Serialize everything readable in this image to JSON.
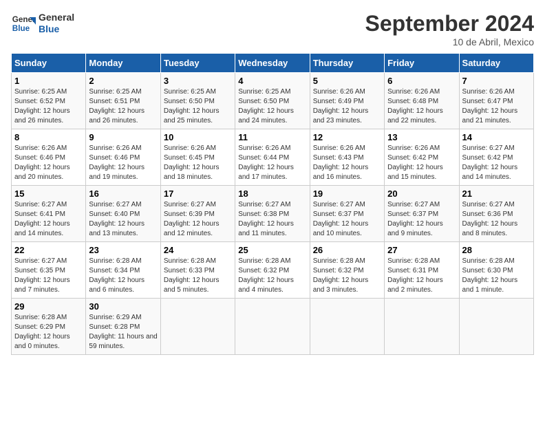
{
  "logo": {
    "line1": "General",
    "line2": "Blue"
  },
  "title": "September 2024",
  "subtitle": "10 de Abril, Mexico",
  "weekdays": [
    "Sunday",
    "Monday",
    "Tuesday",
    "Wednesday",
    "Thursday",
    "Friday",
    "Saturday"
  ],
  "weeks": [
    [
      {
        "day": "1",
        "sunrise": "Sunrise: 6:25 AM",
        "sunset": "Sunset: 6:52 PM",
        "daylight": "Daylight: 12 hours and 26 minutes."
      },
      {
        "day": "2",
        "sunrise": "Sunrise: 6:25 AM",
        "sunset": "Sunset: 6:51 PM",
        "daylight": "Daylight: 12 hours and 26 minutes."
      },
      {
        "day": "3",
        "sunrise": "Sunrise: 6:25 AM",
        "sunset": "Sunset: 6:50 PM",
        "daylight": "Daylight: 12 hours and 25 minutes."
      },
      {
        "day": "4",
        "sunrise": "Sunrise: 6:25 AM",
        "sunset": "Sunset: 6:50 PM",
        "daylight": "Daylight: 12 hours and 24 minutes."
      },
      {
        "day": "5",
        "sunrise": "Sunrise: 6:26 AM",
        "sunset": "Sunset: 6:49 PM",
        "daylight": "Daylight: 12 hours and 23 minutes."
      },
      {
        "day": "6",
        "sunrise": "Sunrise: 6:26 AM",
        "sunset": "Sunset: 6:48 PM",
        "daylight": "Daylight: 12 hours and 22 minutes."
      },
      {
        "day": "7",
        "sunrise": "Sunrise: 6:26 AM",
        "sunset": "Sunset: 6:47 PM",
        "daylight": "Daylight: 12 hours and 21 minutes."
      }
    ],
    [
      {
        "day": "8",
        "sunrise": "Sunrise: 6:26 AM",
        "sunset": "Sunset: 6:46 PM",
        "daylight": "Daylight: 12 hours and 20 minutes."
      },
      {
        "day": "9",
        "sunrise": "Sunrise: 6:26 AM",
        "sunset": "Sunset: 6:46 PM",
        "daylight": "Daylight: 12 hours and 19 minutes."
      },
      {
        "day": "10",
        "sunrise": "Sunrise: 6:26 AM",
        "sunset": "Sunset: 6:45 PM",
        "daylight": "Daylight: 12 hours and 18 minutes."
      },
      {
        "day": "11",
        "sunrise": "Sunrise: 6:26 AM",
        "sunset": "Sunset: 6:44 PM",
        "daylight": "Daylight: 12 hours and 17 minutes."
      },
      {
        "day": "12",
        "sunrise": "Sunrise: 6:26 AM",
        "sunset": "Sunset: 6:43 PM",
        "daylight": "Daylight: 12 hours and 16 minutes."
      },
      {
        "day": "13",
        "sunrise": "Sunrise: 6:26 AM",
        "sunset": "Sunset: 6:42 PM",
        "daylight": "Daylight: 12 hours and 15 minutes."
      },
      {
        "day": "14",
        "sunrise": "Sunrise: 6:27 AM",
        "sunset": "Sunset: 6:42 PM",
        "daylight": "Daylight: 12 hours and 14 minutes."
      }
    ],
    [
      {
        "day": "15",
        "sunrise": "Sunrise: 6:27 AM",
        "sunset": "Sunset: 6:41 PM",
        "daylight": "Daylight: 12 hours and 14 minutes."
      },
      {
        "day": "16",
        "sunrise": "Sunrise: 6:27 AM",
        "sunset": "Sunset: 6:40 PM",
        "daylight": "Daylight: 12 hours and 13 minutes."
      },
      {
        "day": "17",
        "sunrise": "Sunrise: 6:27 AM",
        "sunset": "Sunset: 6:39 PM",
        "daylight": "Daylight: 12 hours and 12 minutes."
      },
      {
        "day": "18",
        "sunrise": "Sunrise: 6:27 AM",
        "sunset": "Sunset: 6:38 PM",
        "daylight": "Daylight: 12 hours and 11 minutes."
      },
      {
        "day": "19",
        "sunrise": "Sunrise: 6:27 AM",
        "sunset": "Sunset: 6:37 PM",
        "daylight": "Daylight: 12 hours and 10 minutes."
      },
      {
        "day": "20",
        "sunrise": "Sunrise: 6:27 AM",
        "sunset": "Sunset: 6:37 PM",
        "daylight": "Daylight: 12 hours and 9 minutes."
      },
      {
        "day": "21",
        "sunrise": "Sunrise: 6:27 AM",
        "sunset": "Sunset: 6:36 PM",
        "daylight": "Daylight: 12 hours and 8 minutes."
      }
    ],
    [
      {
        "day": "22",
        "sunrise": "Sunrise: 6:27 AM",
        "sunset": "Sunset: 6:35 PM",
        "daylight": "Daylight: 12 hours and 7 minutes."
      },
      {
        "day": "23",
        "sunrise": "Sunrise: 6:28 AM",
        "sunset": "Sunset: 6:34 PM",
        "daylight": "Daylight: 12 hours and 6 minutes."
      },
      {
        "day": "24",
        "sunrise": "Sunrise: 6:28 AM",
        "sunset": "Sunset: 6:33 PM",
        "daylight": "Daylight: 12 hours and 5 minutes."
      },
      {
        "day": "25",
        "sunrise": "Sunrise: 6:28 AM",
        "sunset": "Sunset: 6:32 PM",
        "daylight": "Daylight: 12 hours and 4 minutes."
      },
      {
        "day": "26",
        "sunrise": "Sunrise: 6:28 AM",
        "sunset": "Sunset: 6:32 PM",
        "daylight": "Daylight: 12 hours and 3 minutes."
      },
      {
        "day": "27",
        "sunrise": "Sunrise: 6:28 AM",
        "sunset": "Sunset: 6:31 PM",
        "daylight": "Daylight: 12 hours and 2 minutes."
      },
      {
        "day": "28",
        "sunrise": "Sunrise: 6:28 AM",
        "sunset": "Sunset: 6:30 PM",
        "daylight": "Daylight: 12 hours and 1 minute."
      }
    ],
    [
      {
        "day": "29",
        "sunrise": "Sunrise: 6:28 AM",
        "sunset": "Sunset: 6:29 PM",
        "daylight": "Daylight: 12 hours and 0 minutes."
      },
      {
        "day": "30",
        "sunrise": "Sunrise: 6:29 AM",
        "sunset": "Sunset: 6:28 PM",
        "daylight": "Daylight: 11 hours and 59 minutes."
      },
      null,
      null,
      null,
      null,
      null
    ]
  ]
}
